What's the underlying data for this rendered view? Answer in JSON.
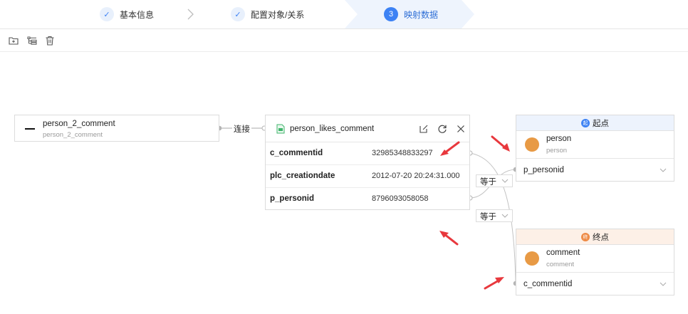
{
  "stepper": {
    "steps": [
      {
        "index": "1",
        "label": "基本信息",
        "state": "done"
      },
      {
        "index": "2",
        "label": "配置对象/关系",
        "state": "done"
      },
      {
        "index": "3",
        "label": "映射数据",
        "state": "active"
      }
    ]
  },
  "toolbar": {
    "tools": [
      {
        "icon": "add-folder-icon"
      },
      {
        "icon": "layout-tree-icon"
      },
      {
        "icon": "trash-icon"
      }
    ]
  },
  "source_node": {
    "title": "person_2_comment",
    "subtitle": "person_2_comment"
  },
  "connect_label": "连接",
  "relation_node": {
    "title": "person_likes_comment",
    "rows": [
      {
        "name": "c_commentid",
        "value": "32985348833297"
      },
      {
        "name": "plc_creationdate",
        "value": "2012-07-20 20:24:31.000"
      },
      {
        "name": "p_personid",
        "value": "8796093058058"
      }
    ]
  },
  "start_node": {
    "header": "起点",
    "badge": "起",
    "title": "person",
    "subtitle": "person",
    "selected": "p_personid"
  },
  "end_node": {
    "header": "终点",
    "badge": "终",
    "title": "comment",
    "subtitle": "comment",
    "selected": "c_commentid"
  },
  "equal_labels": [
    "等于",
    "等于"
  ],
  "colors": {
    "accent": "#3d82f4",
    "start_header": "#edf3fd",
    "end_header": "#fdf0e7",
    "avatar": "#e89a45",
    "annotation_arrow": "#e8383d"
  }
}
